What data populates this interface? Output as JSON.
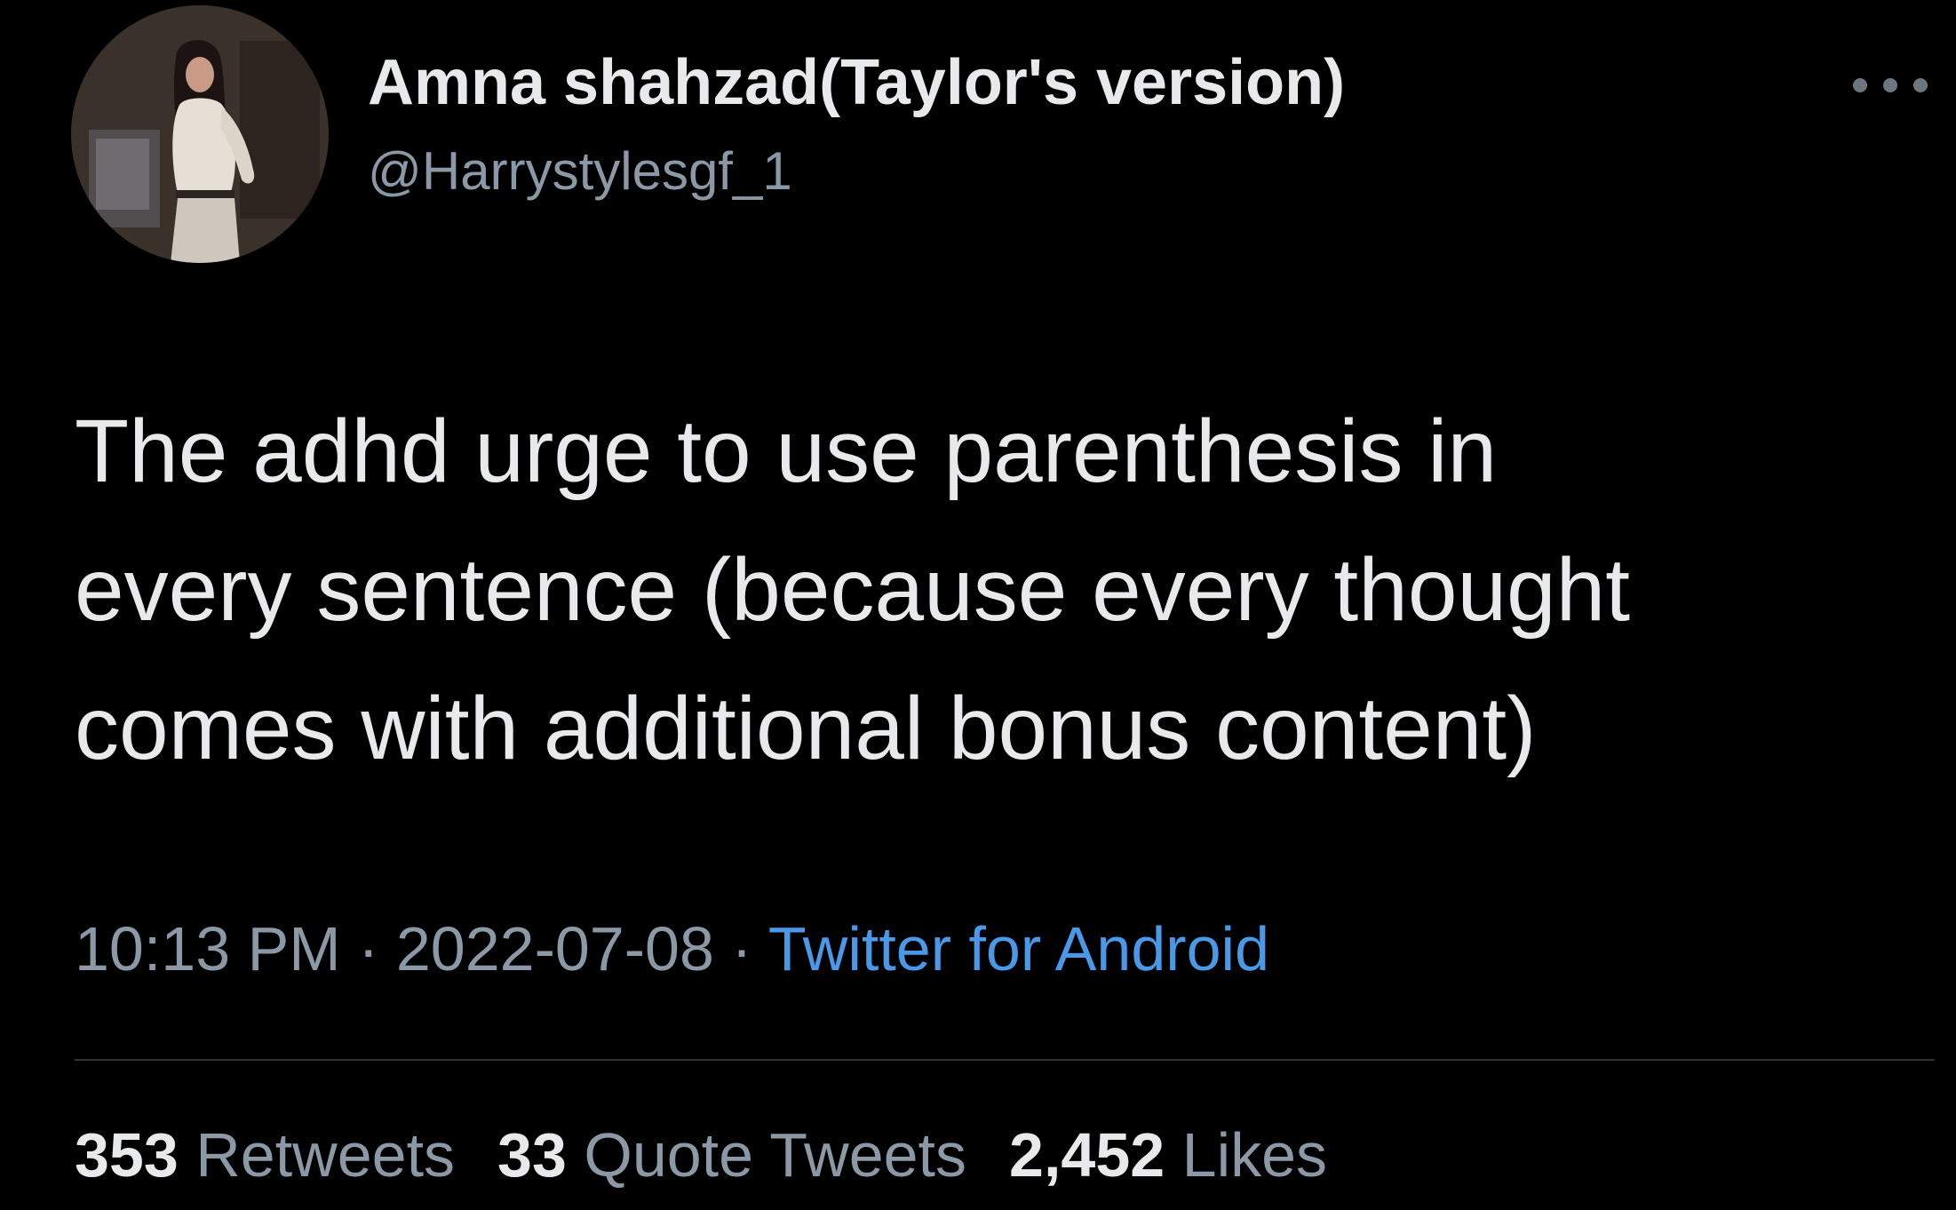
{
  "user": {
    "display_name": "Amna shahzad(Taylor's version)",
    "handle": "@Harrystylesgf_1",
    "avatar_icon": "profile-photo"
  },
  "tweet": {
    "lines": [
      "The adhd urge to use parenthesis in",
      "every sentence (because every thought",
      "comes with additional bonus content)"
    ]
  },
  "meta": {
    "time": "10:13 PM",
    "separator": "·",
    "date": "2022-07-08",
    "source": "Twitter for Android"
  },
  "stats": {
    "retweets_count": "353",
    "retweets_label": "Retweets",
    "quotes_count": "33",
    "quotes_label": "Quote Tweets",
    "likes_count": "2,452",
    "likes_label": "Likes"
  },
  "colors": {
    "background": "#000000",
    "primary_text": "#e7e9ea",
    "secondary_text": "#8b98a5",
    "link": "#4a99e9",
    "divider": "#2f3336"
  },
  "icons": {
    "more": "more-horizontal-icon"
  }
}
